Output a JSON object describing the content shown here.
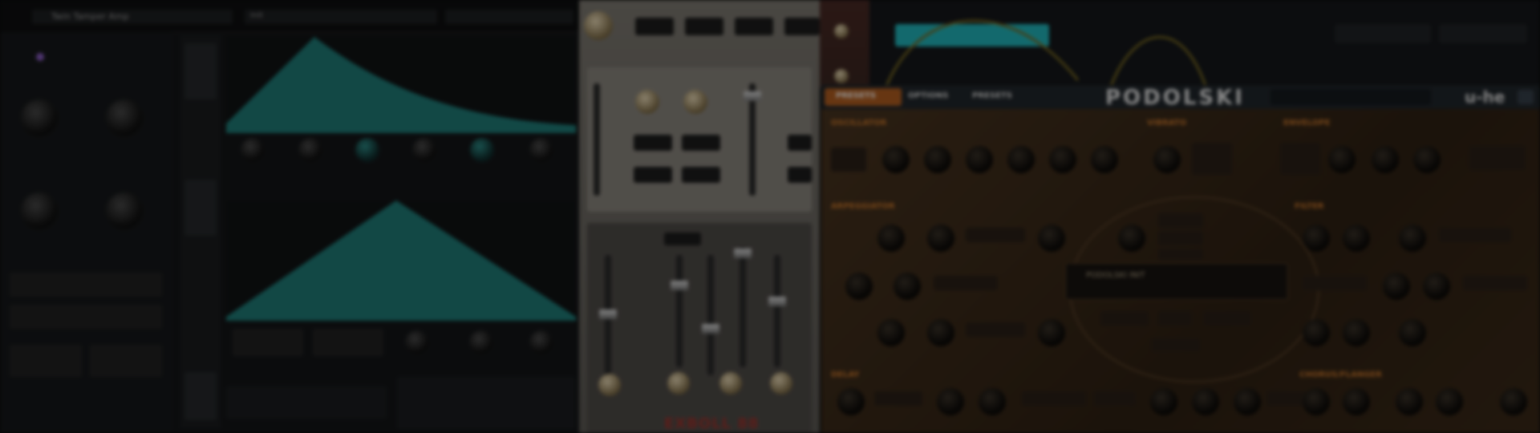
{
  "left_synth": {
    "title": "Twin Tamper Amp",
    "preset": "Init"
  },
  "mixer": {
    "logo": "EXBOLL 88"
  },
  "podolski": {
    "title": "PODOLSKI",
    "brand": "u-he",
    "tabs": [
      "PRESETS",
      "OPTIONS",
      "PRESETS"
    ],
    "sections": {
      "oscillator": "OSCILLATOR",
      "lfo": "VIBRATO",
      "envelope": "ENVELOPE",
      "filter": "FILTER",
      "arpeggiator": "ARPEGGIATOR",
      "chorus": "CHORUS/FLANGER",
      "delay": "DELAY"
    },
    "display": "PODOLSKI INIT"
  },
  "colors": {
    "teal": "#1f7c78",
    "cyan": "#22b6bc",
    "orange": "#b25e20",
    "wood": "#3b2a18"
  }
}
